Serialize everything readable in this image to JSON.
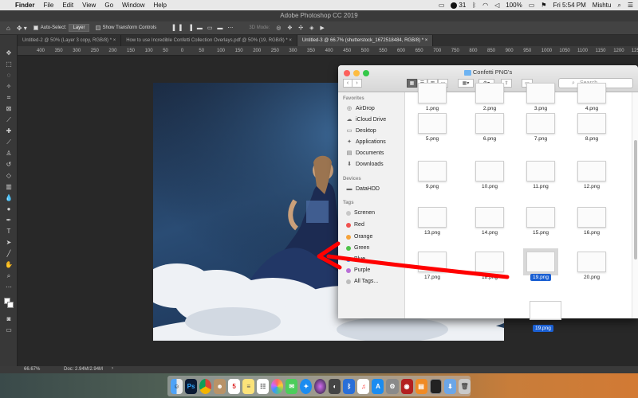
{
  "menubar": {
    "apple": "",
    "items": [
      "Finder",
      "File",
      "Edit",
      "View",
      "Go",
      "Window",
      "Help"
    ],
    "status": {
      "notifications": "31",
      "battery": "100%",
      "time": "Fri 5:54 PM",
      "user": "Mishtu"
    }
  },
  "photoshop": {
    "window_title": "Adobe Photoshop CC 2019",
    "options": {
      "auto_select_label": "Auto-Select:",
      "auto_select_value": "Layer",
      "transform_label": "Show Transform Controls",
      "mode_3d": "3D Mode:"
    },
    "tabs": [
      {
        "label": "Untitled-2 @ 50% (Layer 3 copy, RGB/8) *"
      },
      {
        "label": "How to use Incredible Confetti Collection Overlays.pdf @ 50% (19, RGB/8) *"
      },
      {
        "label": "Untitled-3 @ 66.7% (shutterstock_1672518484, RGB/8) *"
      }
    ],
    "ruler_ticks": [
      "400",
      "350",
      "300",
      "250",
      "200",
      "150",
      "100",
      "50",
      "0",
      "50",
      "100",
      "150",
      "200",
      "250",
      "300",
      "350",
      "400",
      "450",
      "500",
      "550",
      "600",
      "650",
      "700",
      "750",
      "800",
      "850",
      "900",
      "950",
      "1000",
      "1050",
      "1100",
      "1150",
      "1200",
      "1250"
    ],
    "status": {
      "zoom": "66.67%",
      "doc": "Doc: 2.94M/2.94M"
    }
  },
  "finder": {
    "title": "Confetti PNG's",
    "search_placeholder": "Search",
    "favorites_header": "Favorites",
    "favorites": [
      {
        "label": "AirDrop",
        "icon": "airdrop-icon"
      },
      {
        "label": "iCloud Drive",
        "icon": "cloud-icon"
      },
      {
        "label": "Desktop",
        "icon": "desktop-icon"
      },
      {
        "label": "Applications",
        "icon": "applications-icon"
      },
      {
        "label": "Documents",
        "icon": "documents-icon"
      },
      {
        "label": "Downloads",
        "icon": "downloads-icon"
      }
    ],
    "devices_header": "Devices",
    "devices": [
      {
        "label": "DataHDD",
        "icon": "disk-icon"
      }
    ],
    "tags_header": "Tags",
    "tags": [
      {
        "label": "Screnen",
        "color": "#c8c8c8"
      },
      {
        "label": "Red",
        "color": "#f0524f"
      },
      {
        "label": "Orange",
        "color": "#f5a33a"
      },
      {
        "label": "Green",
        "color": "#4fc34a"
      },
      {
        "label": "Blue",
        "color": "#3b8ef0"
      },
      {
        "label": "Purple",
        "color": "#b86fd6"
      },
      {
        "label": "All Tags...",
        "color": "#bdbdbd"
      }
    ],
    "files": [
      "1.png",
      "2.png",
      "3.png",
      "4.png",
      "5.png",
      "6.png",
      "7.png",
      "8.png",
      "9.png",
      "10.png",
      "11.png",
      "12.png",
      "13.png",
      "14.png",
      "15.png",
      "16.png",
      "17.png",
      "18.png",
      "19.png",
      "20.png"
    ],
    "selected_file": "19.png",
    "dragged_file": "19.png"
  }
}
